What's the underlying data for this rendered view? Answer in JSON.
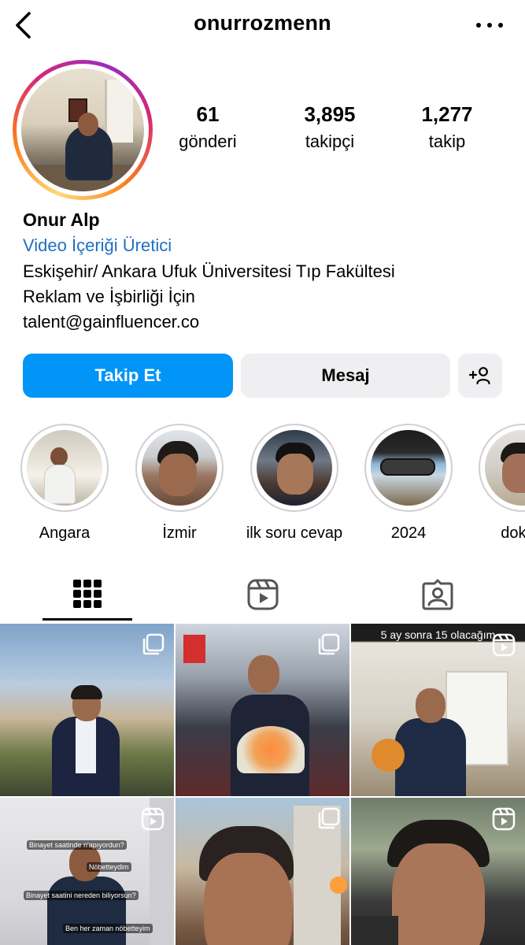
{
  "header": {
    "username": "onurrozmenn",
    "back_icon": "chevron-left-icon",
    "more_icon": "more-horizontal-icon"
  },
  "profile": {
    "stats": {
      "posts": {
        "count": "61",
        "label": "gönderi"
      },
      "followers": {
        "count": "3,895",
        "label": "takipçi"
      },
      "following": {
        "count": "1,277",
        "label": "takip"
      }
    },
    "name": "Onur Alp",
    "category": "Video İçeriği Üretici",
    "bio_lines": [
      "Eskişehir/ Ankara Ufuk Üniversitesi Tıp Fakültesi",
      "Reklam ve İşbirliği İçin",
      "talent@gainfluencer.co"
    ]
  },
  "actions": {
    "follow": "Takip Et",
    "message": "Mesaj",
    "suggest_icon": "add-person-icon",
    "follow_color": "#0095f6"
  },
  "highlights": [
    {
      "label": "Angara"
    },
    {
      "label": "İzmir"
    },
    {
      "label": "ilk soru cevap"
    },
    {
      "label": "2024"
    },
    {
      "label": "doktor"
    }
  ],
  "tabs": [
    {
      "icon": "grid-icon",
      "active": true
    },
    {
      "icon": "reels-icon",
      "active": false
    },
    {
      "icon": "tagged-icon",
      "active": false
    }
  ],
  "grid": {
    "tiles": [
      {
        "badge": "carousel-icon"
      },
      {
        "badge": "carousel-icon"
      },
      {
        "badge": "reels-icon",
        "caption": "5 ay sonra 15 olacağım"
      },
      {
        "badge": "reels-icon",
        "overlay_lines": [
          "Binayet saatinde n'apıyordun?",
          "Nöbetteydim",
          "Binayet saatini nereden biliyorsun?",
          "Ben her zaman nöbetteyim"
        ]
      },
      {
        "badge": "carousel-icon"
      },
      {
        "badge": "reels-icon"
      }
    ]
  }
}
